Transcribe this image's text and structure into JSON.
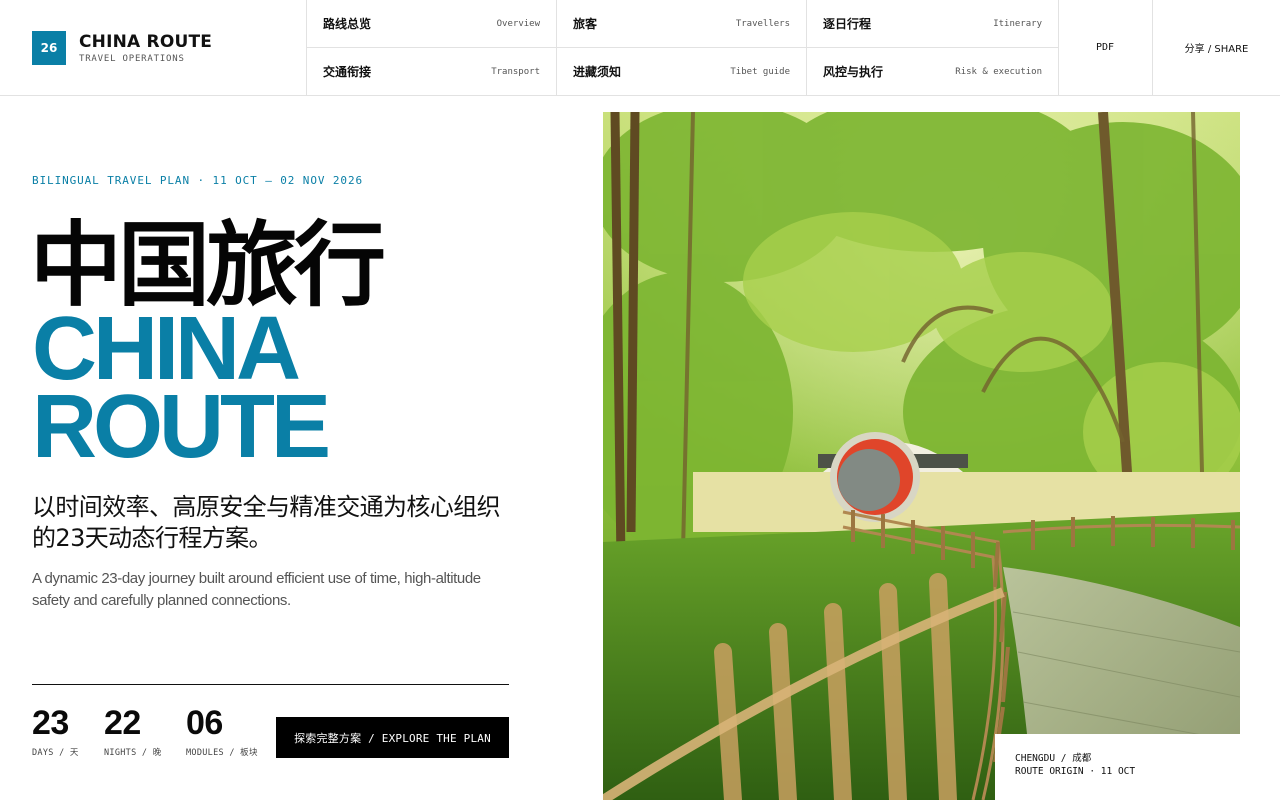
{
  "brand": {
    "badge": "26",
    "title": "CHINA ROUTE",
    "subtitle": "TRAVEL OPERATIONS"
  },
  "nav": [
    {
      "zh": "路线总览",
      "en": "Overview"
    },
    {
      "zh": "旅客",
      "en": "Travellers"
    },
    {
      "zh": "逐日行程",
      "en": "Itinerary"
    },
    {
      "zh": "交通衔接",
      "en": "Transport"
    },
    {
      "zh": "进藏须知",
      "en": "Tibet guide"
    },
    {
      "zh": "风控与执行",
      "en": "Risk & execution"
    }
  ],
  "actions": {
    "pdf": "PDF",
    "share": "分享 / SHARE"
  },
  "hero": {
    "eyebrow": "BILINGUAL TRAVEL PLAN · 11 OCT — 02 NOV 2026",
    "title_zh": "中国旅行",
    "title_en_line1": "CHINA",
    "title_en_line2": "ROUTE",
    "lead_zh": "以时间效率、高原安全与精准交通为核心组织的23天动态行程方案。",
    "lead_en": "A dynamic 23-day journey built around efficient use of time, high-altitude safety and carefully planned connections."
  },
  "stats": [
    {
      "value": "23",
      "label": "DAYS / 天"
    },
    {
      "value": "22",
      "label": "NIGHTS / 晚"
    },
    {
      "value": "06",
      "label": "MODULES / 板块"
    }
  ],
  "cta": {
    "label": "探索完整方案 / EXPLORE THE PLAN"
  },
  "photo_caption": {
    "line1": "CHENGDU / 成都",
    "line2": "ROUTE ORIGIN · 11 OCT"
  },
  "colors": {
    "accent": "#0a7fa6",
    "ink": "#111111",
    "muted": "#555555"
  },
  "icons": {
    "photo": "bamboo-garden-photo"
  }
}
